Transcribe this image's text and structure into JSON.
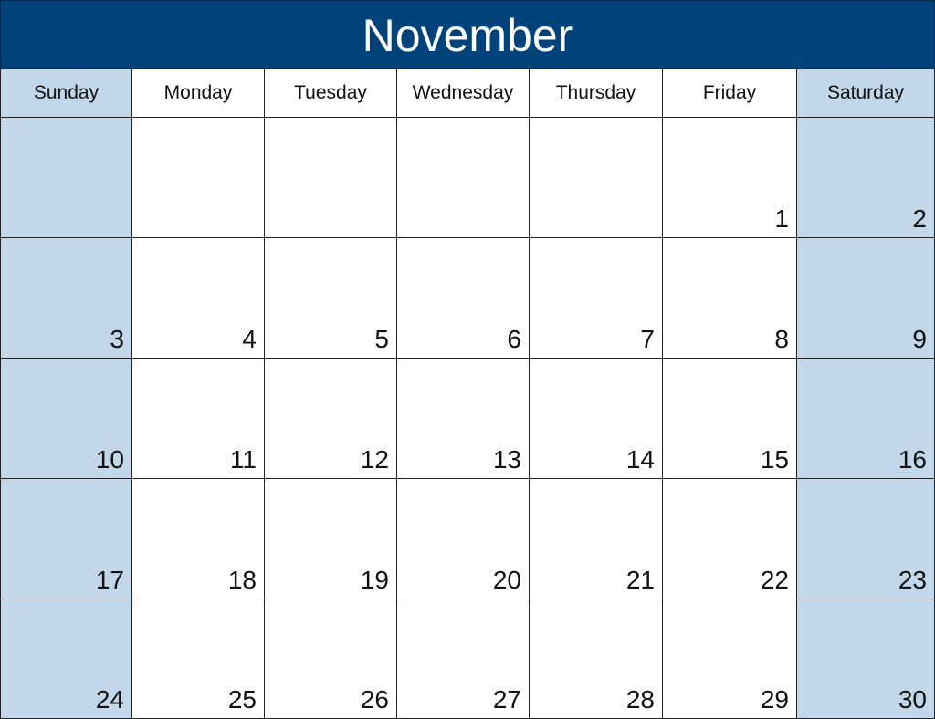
{
  "month": "November",
  "day_names": [
    "Sunday",
    "Monday",
    "Tuesday",
    "Wednesday",
    "Thursday",
    "Friday",
    "Saturday"
  ],
  "colors": {
    "header": "#00427a",
    "weekend": "#c2d7ea"
  },
  "weeks": [
    [
      "",
      "",
      "",
      "",
      "",
      "1",
      "2"
    ],
    [
      "3",
      "4",
      "5",
      "6",
      "7",
      "8",
      "9"
    ],
    [
      "10",
      "11",
      "12",
      "13",
      "14",
      "15",
      "16"
    ],
    [
      "17",
      "18",
      "19",
      "20",
      "21",
      "22",
      "23"
    ],
    [
      "24",
      "25",
      "26",
      "27",
      "28",
      "29",
      "30"
    ]
  ]
}
